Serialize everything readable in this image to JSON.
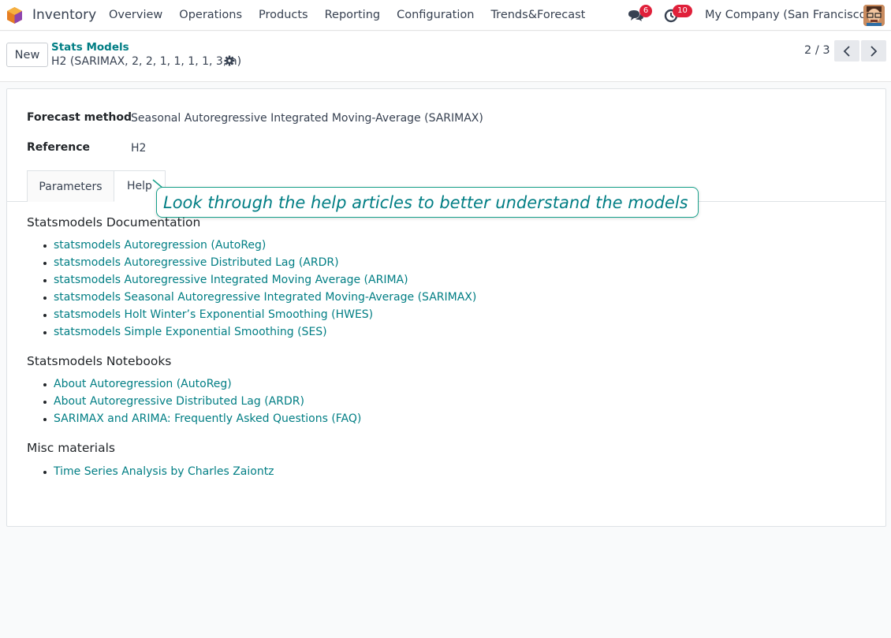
{
  "app": {
    "name": "Inventory"
  },
  "menu": [
    "Overview",
    "Operations",
    "Products",
    "Reporting",
    "Configuration",
    "Trends&Forecast"
  ],
  "systray": {
    "messages_count": "6",
    "activities_count": "10",
    "company": "My Company (San Francisco)",
    "icons": [
      "chat-icon",
      "clock-icon"
    ]
  },
  "control_panel": {
    "new_label": "New",
    "breadcrumb": "Stats Models",
    "record_title": "H2 (SARIMAX, 2, 2, 1, 1, 1, 1, 3, n)",
    "pager": "2 / 3"
  },
  "form": {
    "forecast_method_label": "Forecast method",
    "forecast_method_value": "Seasonal Autoregressive Integrated Moving-Average (SARIMAX)",
    "reference_label": "Reference",
    "reference_value": "H2",
    "tabs": [
      "Parameters",
      "Help"
    ]
  },
  "tooltip": "Look through the help articles to better understand the models",
  "help": {
    "sections": [
      {
        "title": "Statsmodels Documentation",
        "links": [
          "statsmodels Autoregression (AutoReg)",
          "statsmodels Autoregressive Distributed Lag (ARDR)",
          "statsmodels Autoregressive Integrated Moving Average (ARIMA)",
          "statsmodels Seasonal Autoregressive Integrated Moving-Average (SARIMAX)",
          "statsmodels Holt Winter’s Exponential Smoothing (HWES)",
          "statsmodels Simple Exponential Smoothing (SES)"
        ]
      },
      {
        "title": "Statsmodels Notebooks",
        "links": [
          "About Autoregression (AutoReg)",
          "About Autoregressive Distributed Lag (ARDR)",
          "SARIMAX and ARIMA: Frequently Asked Questions (FAQ)"
        ]
      },
      {
        "title": "Misc materials",
        "links": [
          "Time Series Analysis by Charles Zaiontz"
        ]
      }
    ]
  },
  "colors": {
    "link": "#017e84",
    "badge": "#e0203a",
    "tooltip_border": "#17a08a"
  }
}
